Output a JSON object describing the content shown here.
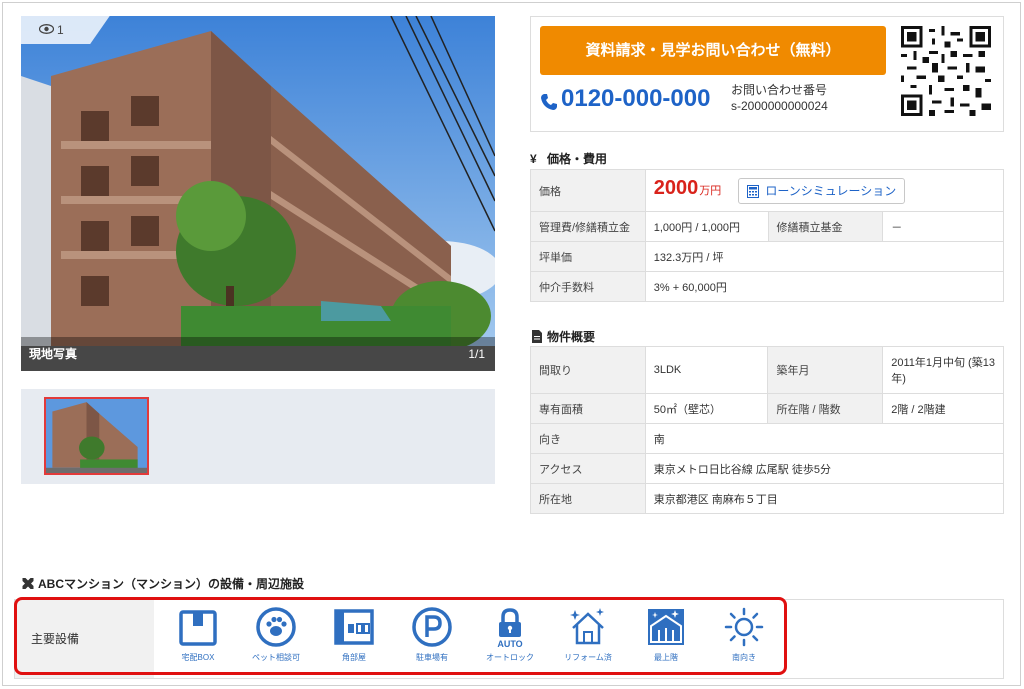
{
  "photo": {
    "view_count": "1",
    "caption": "現地写真",
    "counter": "1/1"
  },
  "contact": {
    "cta_label": "資料請求・見学お問い合わせ（無料）",
    "phone": "0120-000-000",
    "inquiry_label": "お問い合わせ番号",
    "inquiry_number": "s-2000000000024"
  },
  "price_section": {
    "title": "価格・費用",
    "rows": {
      "price_label": "価格",
      "price_value": "2000",
      "price_unit": "万円",
      "loan_button": "ローンシミュレーション",
      "mgmt_label": "管理費/修繕積立金",
      "mgmt_value": "1,000円 / 1,000円",
      "repair_fund_label": "修繕積立基金",
      "repair_fund_value": "－",
      "tsubo_label": "坪単価",
      "tsubo_value": "132.3万円 / 坪",
      "commission_label": "仲介手数料",
      "commission_value": "3% + 60,000円"
    }
  },
  "overview": {
    "title": "物件概要",
    "rows": {
      "layout_label": "間取り",
      "layout_value": "3LDK",
      "built_label": "築年月",
      "built_value": "2011年1月中旬 (築13年)",
      "area_label": "専有面積",
      "area_value": "50㎡（壁芯）",
      "floor_label": "所在階 / 階数",
      "floor_value": "2階 / 2階建",
      "direction_label": "向き",
      "direction_value": "南",
      "access_label": "アクセス",
      "access_value": "東京メトロ日比谷線 広尾駅 徒歩5分",
      "address_label": "所在地",
      "address_value": "東京都港区 南麻布５丁目"
    }
  },
  "facilities": {
    "title": "ABCマンション（マンション）の設備・周辺施設",
    "row_label": "主要設備",
    "items": [
      {
        "label": "宅配BOX",
        "icon": "box-icon"
      },
      {
        "label": "ペット相談可",
        "icon": "paw-icon"
      },
      {
        "label": "角部屋",
        "icon": "corner-room-icon"
      },
      {
        "label": "駐車場有",
        "icon": "parking-icon"
      },
      {
        "label": "オートロック",
        "icon": "autolock-icon",
        "badge": "AUTO"
      },
      {
        "label": "リフォーム済",
        "icon": "sparkle-house-icon"
      },
      {
        "label": "最上階",
        "icon": "top-floor-icon"
      },
      {
        "label": "南向き",
        "icon": "sun-icon"
      }
    ]
  },
  "colors": {
    "accent_blue": "#1e63c7",
    "cta_orange": "#f08a00",
    "price_red": "#d9231b",
    "highlight_red": "#e01010"
  }
}
